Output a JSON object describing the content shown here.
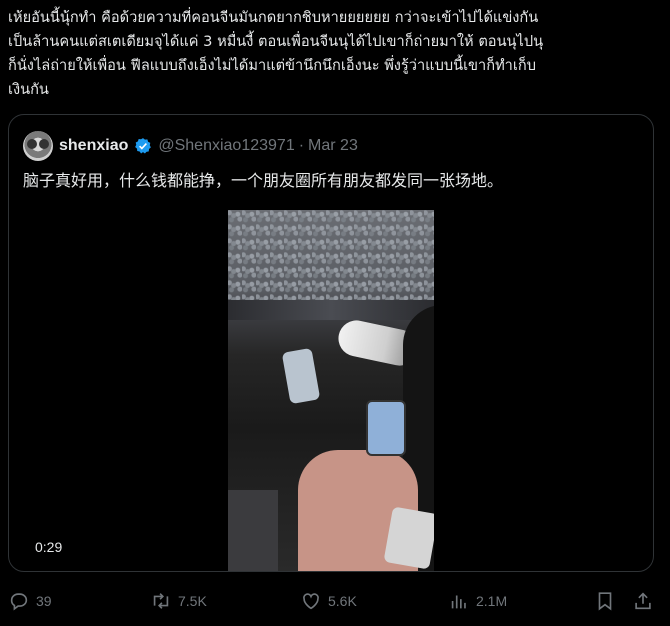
{
  "post": {
    "text": "เห้ยอันนี้นุ้กทำ คือด้วยความที่คอนจีนมันกดยากชิบหายยยยยย กว่าจะเข้าไปได้แข่งกัน\nเป็นล้านคนแต่สเตเดียมจุได้แค่ 3 หมื่นงี้ ตอนเพื่อนจีนนุได้ไปเขาก็ถ่ายมาให้ ตอนนุไปนุ\nก็นั่งไล่ถ่ายให้เพื่อน ฟีลแบบถึงเอ็งไม่ได้มาแต่ข้านึกนึกเอ็งนะ พึ่งรู้ว่าแบบนี้เขาก็ทำเก็บ\nเงินกัน"
  },
  "quoted_post": {
    "author_name": "shenxiao",
    "handle": "@Shenxiao123971",
    "separator": "·",
    "date": "Mar 23",
    "text": "脑子真好用，什么钱都能挣，一个朋友圈所有朋友都发同一张场地。",
    "video_duration": "0:29",
    "verified_color": "#1d9bf0"
  },
  "actions": {
    "replies": "39",
    "reposts": "7.5K",
    "likes": "5.6K",
    "views": "2.1M"
  },
  "icons": [
    "reply-icon",
    "repost-icon",
    "like-icon",
    "views-icon",
    "bookmark-icon",
    "share-icon",
    "verified-icon"
  ]
}
